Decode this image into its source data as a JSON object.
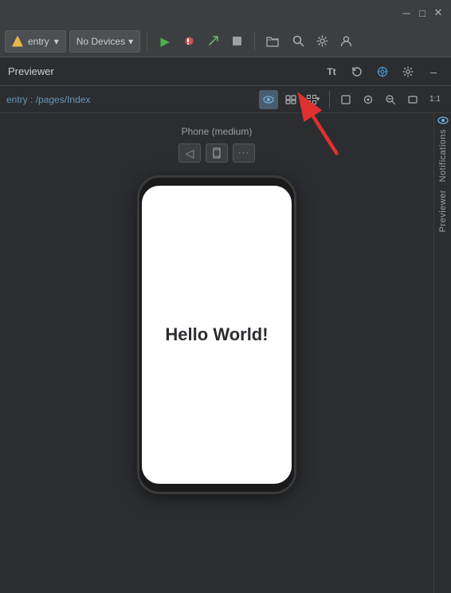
{
  "titlebar": {
    "minimize_label": "─",
    "maximize_label": "□",
    "close_label": "✕"
  },
  "toolbar": {
    "entry_label": "entry",
    "entry_dropdown_arrow": "▾",
    "devices_label": "No Devices",
    "devices_dropdown_arrow": "▾",
    "run_icon": "▶",
    "debug_icon": "🐞",
    "attach_icon": "🔌",
    "stop_icon": "■",
    "open_icon": "📂",
    "search_icon": "🔍",
    "settings_icon": "⚙",
    "account_icon": "👤"
  },
  "panel": {
    "title": "Previewer",
    "text_format_icon": "Tt",
    "refresh_icon": "↻",
    "target_icon": "⊕",
    "settings_icon": "⚙",
    "close_icon": "–"
  },
  "sub_toolbar": {
    "path_prefix": "entry",
    "path_separator": " : ",
    "path_value": "/pages/Index",
    "eye_icon": "👁",
    "layers_icon": "◫",
    "grid_icon": "⊞",
    "dropdown_arrow": "▾",
    "frame_icon": "▭",
    "pin_icon": "⊕",
    "zoom_out_icon": "−",
    "frame2_icon": "▭",
    "ratio_label": "1:1"
  },
  "device": {
    "label": "Phone (medium)",
    "back_icon": "◁",
    "rotate_icon": "⧉",
    "more_icon": "···"
  },
  "screen": {
    "hello_world_text": "Hello World!"
  },
  "right_sidebar": {
    "notifications_label": "Notifications",
    "previewer_label": "Previewer",
    "eye_icon": "👁"
  }
}
